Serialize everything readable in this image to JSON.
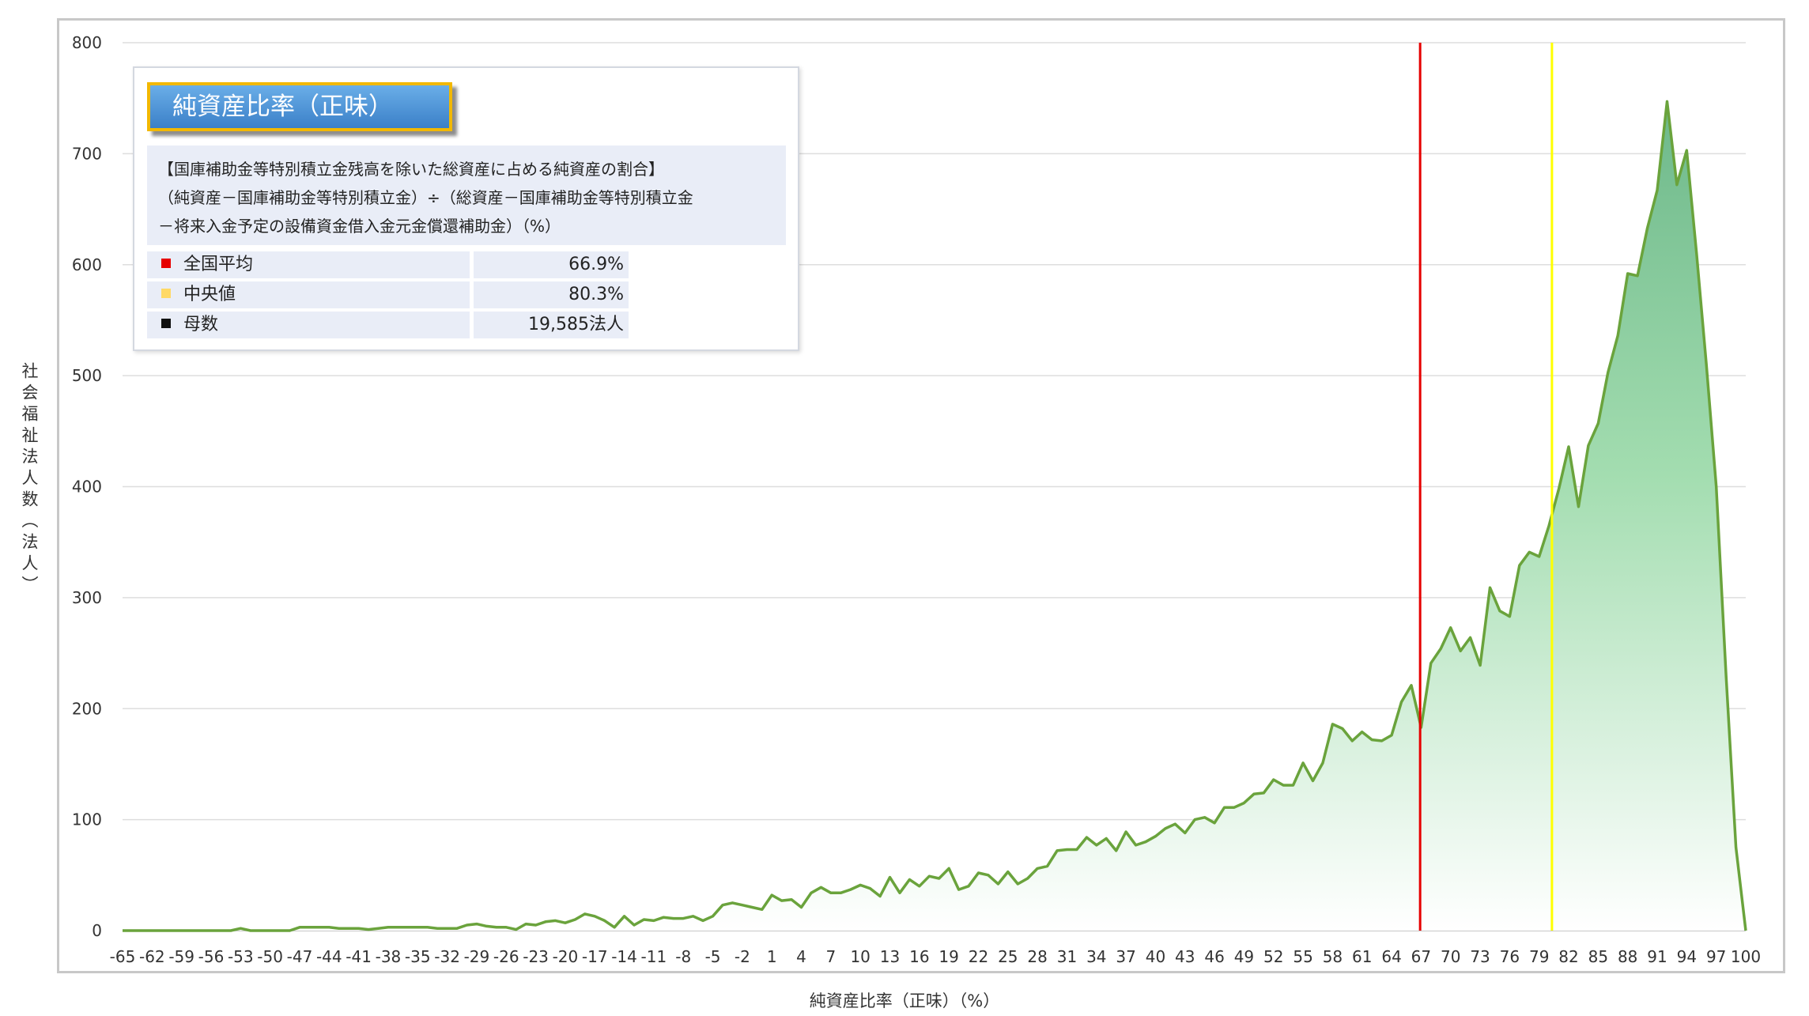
{
  "chart_data": {
    "type": "area",
    "ylabel": "社会福祉法人数（法人）",
    "xlabel": "純資産比率（正味）（%）",
    "ylim": [
      0,
      800
    ],
    "yticks": [
      0,
      100,
      200,
      300,
      400,
      500,
      600,
      700,
      800
    ],
    "xlim": [
      -65,
      100
    ],
    "xticks": [
      -65,
      -62,
      -59,
      -56,
      -53,
      -50,
      -47,
      -44,
      -41,
      -38,
      -35,
      -32,
      -29,
      -26,
      -23,
      -20,
      -17,
      -14,
      -11,
      -8,
      -5,
      -2,
      1,
      4,
      7,
      10,
      13,
      16,
      19,
      22,
      25,
      28,
      31,
      34,
      37,
      40,
      43,
      46,
      49,
      52,
      55,
      58,
      61,
      64,
      67,
      70,
      73,
      76,
      79,
      82,
      85,
      88,
      91,
      94,
      97,
      100
    ],
    "grid": "horizontal",
    "fill_color_top": "#6db88a",
    "fill_color_bottom": "#ffffff",
    "line_color": "#6aa33c",
    "series": [
      {
        "x": [
          -65,
          -64,
          -63,
          -62,
          -61,
          -60,
          -59,
          -58,
          -57,
          -56,
          -55,
          -54,
          -53,
          -52,
          -51,
          -50,
          -49,
          -48,
          -47,
          -46,
          -45,
          -44,
          -43,
          -42,
          -41,
          -40,
          -39,
          -38,
          -37,
          -36,
          -35,
          -34,
          -33,
          -32,
          -31,
          -30,
          -29,
          -28,
          -27,
          -26,
          -25,
          -24,
          -23,
          -22,
          -21,
          -20,
          -19,
          -18,
          -17,
          -16,
          -15,
          -14,
          -13,
          -12,
          -11,
          -10,
          -9,
          -8,
          -7,
          -6,
          -5,
          -4,
          -3,
          -2,
          -1,
          0,
          1,
          2,
          3,
          4,
          5,
          6,
          7,
          8,
          9,
          10,
          11,
          12,
          13,
          14,
          15,
          16,
          17,
          18,
          19,
          20,
          21,
          22,
          23,
          24,
          25,
          26,
          27,
          28,
          29,
          30,
          31,
          32,
          33,
          34,
          35,
          36,
          37,
          38,
          39,
          40,
          41,
          42,
          43,
          44,
          45,
          46,
          47,
          48,
          49,
          50,
          51,
          52,
          53,
          54,
          55,
          56,
          57,
          58,
          59,
          60,
          61,
          62,
          63,
          64,
          65,
          66,
          67,
          68,
          69,
          70,
          71,
          72,
          73,
          74,
          75,
          76,
          77,
          78,
          79,
          80,
          81,
          82,
          83,
          84,
          85,
          86,
          87,
          88,
          89,
          90,
          91,
          92,
          93,
          94,
          95,
          96,
          97,
          98,
          99,
          100
        ],
        "values": [
          0,
          0,
          0,
          0,
          0,
          0,
          0,
          0,
          0,
          0,
          0,
          0,
          2,
          0,
          0,
          0,
          0,
          0,
          3,
          3,
          3,
          3,
          2,
          2,
          2,
          1,
          2,
          3,
          3,
          3,
          3,
          3,
          2,
          2,
          2,
          5,
          6,
          4,
          3,
          3,
          1,
          6,
          5,
          8,
          9,
          7,
          10,
          15,
          13,
          9,
          3,
          13,
          5,
          10,
          9,
          12,
          11,
          11,
          13,
          9,
          13,
          23,
          25,
          23,
          21,
          19,
          32,
          27,
          28,
          21,
          34,
          39,
          34,
          34,
          37,
          41,
          38,
          31,
          48,
          34,
          46,
          40,
          49,
          47,
          56,
          37,
          40,
          52,
          50,
          42,
          53,
          42,
          47,
          56,
          58,
          72,
          73,
          73,
          84,
          77,
          83,
          72,
          89,
          77,
          80,
          85,
          92,
          96,
          88,
          100,
          102,
          97,
          111,
          111,
          115,
          123,
          124,
          136,
          131,
          131,
          151,
          135,
          151,
          186,
          182,
          171,
          179,
          172,
          171,
          176,
          206,
          221,
          183,
          241,
          254,
          273,
          252,
          264,
          239,
          309,
          288,
          283,
          329,
          341,
          337,
          365,
          398,
          436,
          382,
          437,
          457,
          503,
          536,
          592,
          590,
          633,
          667,
          747,
          672,
          703,
          610,
          510,
          400,
          230,
          75,
          0
        ]
      }
    ],
    "vlines": [
      {
        "x": 66.9,
        "color": "#e60000"
      },
      {
        "x": 80.3,
        "color": "#ffff00"
      }
    ]
  },
  "info": {
    "title": "純資産比率（正味）",
    "desc_line1": "【国庫補助金等特別積立金残高を除いた総資産に占める純資産の割合】",
    "desc_line2": "（純資産－国庫補助金等特別積立金）÷（総資産－国庫補助金等特別積立金",
    "desc_line3": "－将来入金予定の設備資金借入金元金償還補助金）（%）",
    "stats": [
      {
        "label": "全国平均",
        "value": "66.9%",
        "color": "#e60000"
      },
      {
        "label": "中央値",
        "value": "80.3%",
        "color": "#ffd966"
      },
      {
        "label": "母数",
        "value": "19,585法人",
        "color": "#111111"
      }
    ]
  }
}
